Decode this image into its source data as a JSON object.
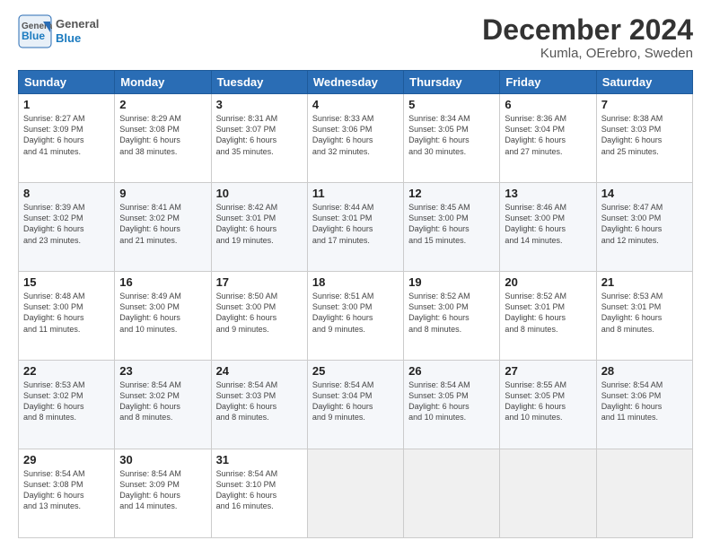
{
  "logo": {
    "line1": "General",
    "line2": "Blue"
  },
  "title": "December 2024",
  "location": "Kumla, OErebro, Sweden",
  "days_of_week": [
    "Sunday",
    "Monday",
    "Tuesday",
    "Wednesday",
    "Thursday",
    "Friday",
    "Saturday"
  ],
  "weeks": [
    [
      {
        "day": "1",
        "detail": "Sunrise: 8:27 AM\nSunset: 3:09 PM\nDaylight: 6 hours\nand 41 minutes."
      },
      {
        "day": "2",
        "detail": "Sunrise: 8:29 AM\nSunset: 3:08 PM\nDaylight: 6 hours\nand 38 minutes."
      },
      {
        "day": "3",
        "detail": "Sunrise: 8:31 AM\nSunset: 3:07 PM\nDaylight: 6 hours\nand 35 minutes."
      },
      {
        "day": "4",
        "detail": "Sunrise: 8:33 AM\nSunset: 3:06 PM\nDaylight: 6 hours\nand 32 minutes."
      },
      {
        "day": "5",
        "detail": "Sunrise: 8:34 AM\nSunset: 3:05 PM\nDaylight: 6 hours\nand 30 minutes."
      },
      {
        "day": "6",
        "detail": "Sunrise: 8:36 AM\nSunset: 3:04 PM\nDaylight: 6 hours\nand 27 minutes."
      },
      {
        "day": "7",
        "detail": "Sunrise: 8:38 AM\nSunset: 3:03 PM\nDaylight: 6 hours\nand 25 minutes."
      }
    ],
    [
      {
        "day": "8",
        "detail": "Sunrise: 8:39 AM\nSunset: 3:02 PM\nDaylight: 6 hours\nand 23 minutes."
      },
      {
        "day": "9",
        "detail": "Sunrise: 8:41 AM\nSunset: 3:02 PM\nDaylight: 6 hours\nand 21 minutes."
      },
      {
        "day": "10",
        "detail": "Sunrise: 8:42 AM\nSunset: 3:01 PM\nDaylight: 6 hours\nand 19 minutes."
      },
      {
        "day": "11",
        "detail": "Sunrise: 8:44 AM\nSunset: 3:01 PM\nDaylight: 6 hours\nand 17 minutes."
      },
      {
        "day": "12",
        "detail": "Sunrise: 8:45 AM\nSunset: 3:00 PM\nDaylight: 6 hours\nand 15 minutes."
      },
      {
        "day": "13",
        "detail": "Sunrise: 8:46 AM\nSunset: 3:00 PM\nDaylight: 6 hours\nand 14 minutes."
      },
      {
        "day": "14",
        "detail": "Sunrise: 8:47 AM\nSunset: 3:00 PM\nDaylight: 6 hours\nand 12 minutes."
      }
    ],
    [
      {
        "day": "15",
        "detail": "Sunrise: 8:48 AM\nSunset: 3:00 PM\nDaylight: 6 hours\nand 11 minutes."
      },
      {
        "day": "16",
        "detail": "Sunrise: 8:49 AM\nSunset: 3:00 PM\nDaylight: 6 hours\nand 10 minutes."
      },
      {
        "day": "17",
        "detail": "Sunrise: 8:50 AM\nSunset: 3:00 PM\nDaylight: 6 hours\nand 9 minutes."
      },
      {
        "day": "18",
        "detail": "Sunrise: 8:51 AM\nSunset: 3:00 PM\nDaylight: 6 hours\nand 9 minutes."
      },
      {
        "day": "19",
        "detail": "Sunrise: 8:52 AM\nSunset: 3:00 PM\nDaylight: 6 hours\nand 8 minutes."
      },
      {
        "day": "20",
        "detail": "Sunrise: 8:52 AM\nSunset: 3:01 PM\nDaylight: 6 hours\nand 8 minutes."
      },
      {
        "day": "21",
        "detail": "Sunrise: 8:53 AM\nSunset: 3:01 PM\nDaylight: 6 hours\nand 8 minutes."
      }
    ],
    [
      {
        "day": "22",
        "detail": "Sunrise: 8:53 AM\nSunset: 3:02 PM\nDaylight: 6 hours\nand 8 minutes."
      },
      {
        "day": "23",
        "detail": "Sunrise: 8:54 AM\nSunset: 3:02 PM\nDaylight: 6 hours\nand 8 minutes."
      },
      {
        "day": "24",
        "detail": "Sunrise: 8:54 AM\nSunset: 3:03 PM\nDaylight: 6 hours\nand 8 minutes."
      },
      {
        "day": "25",
        "detail": "Sunrise: 8:54 AM\nSunset: 3:04 PM\nDaylight: 6 hours\nand 9 minutes."
      },
      {
        "day": "26",
        "detail": "Sunrise: 8:54 AM\nSunset: 3:05 PM\nDaylight: 6 hours\nand 10 minutes."
      },
      {
        "day": "27",
        "detail": "Sunrise: 8:55 AM\nSunset: 3:05 PM\nDaylight: 6 hours\nand 10 minutes."
      },
      {
        "day": "28",
        "detail": "Sunrise: 8:54 AM\nSunset: 3:06 PM\nDaylight: 6 hours\nand 11 minutes."
      }
    ],
    [
      {
        "day": "29",
        "detail": "Sunrise: 8:54 AM\nSunset: 3:08 PM\nDaylight: 6 hours\nand 13 minutes."
      },
      {
        "day": "30",
        "detail": "Sunrise: 8:54 AM\nSunset: 3:09 PM\nDaylight: 6 hours\nand 14 minutes."
      },
      {
        "day": "31",
        "detail": "Sunrise: 8:54 AM\nSunset: 3:10 PM\nDaylight: 6 hours\nand 16 minutes."
      },
      {
        "day": "",
        "detail": ""
      },
      {
        "day": "",
        "detail": ""
      },
      {
        "day": "",
        "detail": ""
      },
      {
        "day": "",
        "detail": ""
      }
    ]
  ]
}
